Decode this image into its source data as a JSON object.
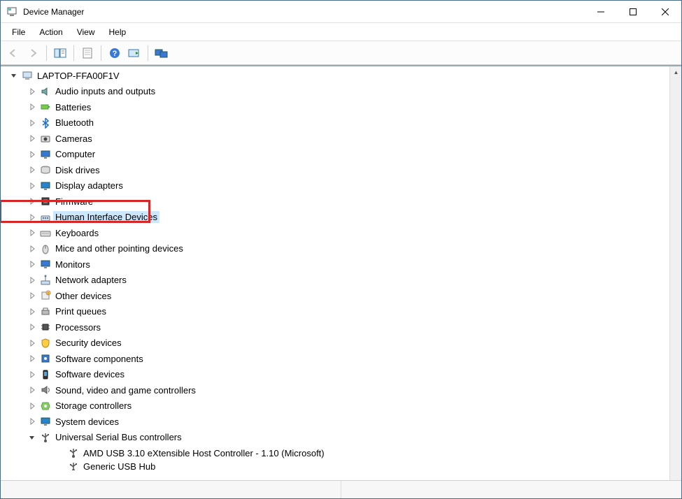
{
  "window": {
    "title": "Device Manager"
  },
  "menu": {
    "items": [
      "File",
      "Action",
      "View",
      "Help"
    ]
  },
  "toolbar": {
    "back": "back",
    "forward": "forward",
    "properties": "properties",
    "help": "help",
    "scan": "scan",
    "monitors": "monitors"
  },
  "tree": {
    "root": {
      "label": "LAPTOP-FFA00F1V",
      "expanded": true,
      "icon": "computer-icon"
    },
    "nodes": [
      {
        "label": "Audio inputs and outputs",
        "icon": "audio-icon",
        "expanded": false
      },
      {
        "label": "Batteries",
        "icon": "battery-icon",
        "expanded": false
      },
      {
        "label": "Bluetooth",
        "icon": "bluetooth-icon",
        "expanded": false
      },
      {
        "label": "Cameras",
        "icon": "camera-icon",
        "expanded": false
      },
      {
        "label": "Computer",
        "icon": "monitor-icon",
        "expanded": false
      },
      {
        "label": "Disk drives",
        "icon": "disk-icon",
        "expanded": false
      },
      {
        "label": "Display adapters",
        "icon": "display-icon",
        "expanded": false
      },
      {
        "label": "Firmware",
        "icon": "firmware-icon",
        "expanded": false
      },
      {
        "label": "Human Interface Devices",
        "icon": "hid-icon",
        "expanded": false,
        "selected": true,
        "highlighted": true
      },
      {
        "label": "Keyboards",
        "icon": "keyboard-icon",
        "expanded": false
      },
      {
        "label": "Mice and other pointing devices",
        "icon": "mouse-icon",
        "expanded": false
      },
      {
        "label": "Monitors",
        "icon": "monitor-icon",
        "expanded": false
      },
      {
        "label": "Network adapters",
        "icon": "network-icon",
        "expanded": false
      },
      {
        "label": "Other devices",
        "icon": "other-icon",
        "expanded": false
      },
      {
        "label": "Print queues",
        "icon": "printer-icon",
        "expanded": false
      },
      {
        "label": "Processors",
        "icon": "cpu-icon",
        "expanded": false
      },
      {
        "label": "Security devices",
        "icon": "security-icon",
        "expanded": false
      },
      {
        "label": "Software components",
        "icon": "software-comp-icon",
        "expanded": false
      },
      {
        "label": "Software devices",
        "icon": "software-dev-icon",
        "expanded": false
      },
      {
        "label": "Sound, video and game controllers",
        "icon": "sound-icon",
        "expanded": false
      },
      {
        "label": "Storage controllers",
        "icon": "storage-icon",
        "expanded": false
      },
      {
        "label": "System devices",
        "icon": "system-icon",
        "expanded": false
      },
      {
        "label": "Universal Serial Bus controllers",
        "icon": "usb-icon",
        "expanded": true,
        "children": [
          {
            "label": "AMD USB 3.10 eXtensible Host Controller - 1.10 (Microsoft)",
            "icon": "usb-icon"
          },
          {
            "label": "Generic USB Hub",
            "icon": "usb-icon",
            "cutoff": true
          }
        ]
      }
    ]
  }
}
